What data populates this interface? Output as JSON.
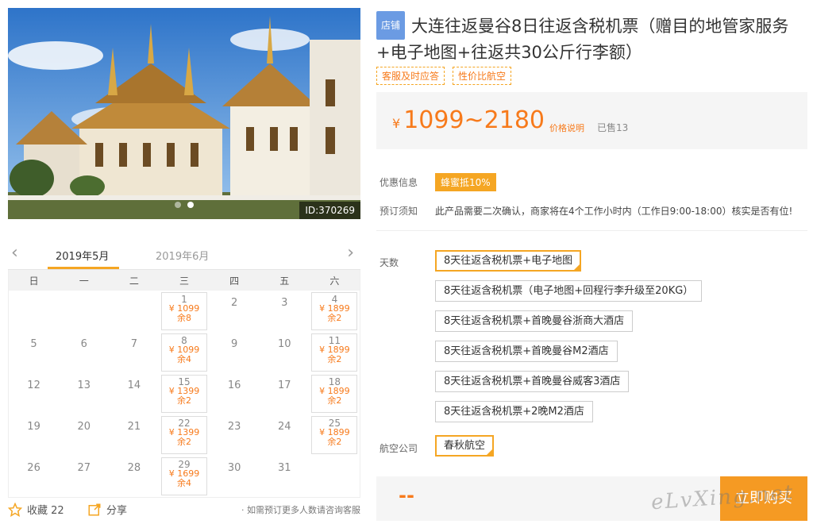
{
  "hero": {
    "image_id": "ID:370269",
    "slide_count": 2,
    "active_slide": 2
  },
  "calendar": {
    "months": [
      "2019年5月",
      "2019年6月"
    ],
    "active_month": 0,
    "weekdays": [
      "日",
      "一",
      "二",
      "三",
      "四",
      "五",
      "六"
    ],
    "weeks": [
      [
        {
          "d": ""
        },
        {
          "d": ""
        },
        {
          "d": ""
        },
        {
          "d": "1",
          "price": "¥ 1099",
          "rem": "余8"
        },
        {
          "d": "2"
        },
        {
          "d": "3"
        },
        {
          "d": "4",
          "price": "¥ 1899",
          "rem": "余2"
        }
      ],
      [
        {
          "d": "5"
        },
        {
          "d": "6"
        },
        {
          "d": "7"
        },
        {
          "d": "8",
          "price": "¥ 1099",
          "rem": "余4"
        },
        {
          "d": "9"
        },
        {
          "d": "10"
        },
        {
          "d": "11",
          "price": "¥ 1899",
          "rem": "余2"
        }
      ],
      [
        {
          "d": "12"
        },
        {
          "d": "13"
        },
        {
          "d": "14"
        },
        {
          "d": "15",
          "price": "¥ 1399",
          "rem": "余2"
        },
        {
          "d": "16"
        },
        {
          "d": "17"
        },
        {
          "d": "18",
          "price": "¥ 1899",
          "rem": "余2"
        }
      ],
      [
        {
          "d": "19"
        },
        {
          "d": "20"
        },
        {
          "d": "21"
        },
        {
          "d": "22",
          "price": "¥ 1399",
          "rem": "余2"
        },
        {
          "d": "23"
        },
        {
          "d": "24"
        },
        {
          "d": "25",
          "price": "¥ 1899",
          "rem": "余2"
        }
      ],
      [
        {
          "d": "26"
        },
        {
          "d": "27"
        },
        {
          "d": "28"
        },
        {
          "d": "29",
          "price": "¥ 1699",
          "rem": "余4"
        },
        {
          "d": "30"
        },
        {
          "d": "31"
        },
        {
          "d": ""
        }
      ]
    ]
  },
  "footer": {
    "favorite_label": "收藏 22",
    "share_label": "分享",
    "consult_note": "· 如需预订更多人数请咨询客服"
  },
  "product": {
    "shop_badge": "店铺",
    "title": "大连往返曼谷8日往返含税机票（赠目的地管家服务+电子地图+往返共30公斤行李额）",
    "tags": [
      "客服及时应答",
      "性价比航空"
    ],
    "price_symbol": "¥",
    "price_range": "1099~2180",
    "price_note": "价格说明",
    "sold": "已售13"
  },
  "info": {
    "promo_label": "优惠信息",
    "promo_value": "蜂蜜抵10%",
    "booking_label": "预订须知",
    "booking_value": "此产品需要二次确认，商家将在4个工作小时内（工作日9:00-18:00）核实是否有位!"
  },
  "options": {
    "days_label": "天数",
    "days": [
      "8天往返含税机票+电子地图",
      "8天往返含税机票（电子地图+回程行李升级至20KG）",
      "8天往返含税机票+首晚曼谷浙商大酒店",
      "8天往返含税机票+首晚曼谷M2酒店",
      "8天往返含税机票+首晚曼谷威客3酒店",
      "8天往返含税机票+2晚M2酒店"
    ],
    "selected_day": 0,
    "airline_label": "航空公司",
    "airlines": [
      "春秋航空"
    ]
  },
  "buy": {
    "price_placeholder": "--",
    "button_label": "立即购买",
    "watermark": "eLvXing.net"
  },
  "colors": {
    "accent": "#f5a623",
    "price": "#f77a1b",
    "badge": "#6b9be3"
  }
}
